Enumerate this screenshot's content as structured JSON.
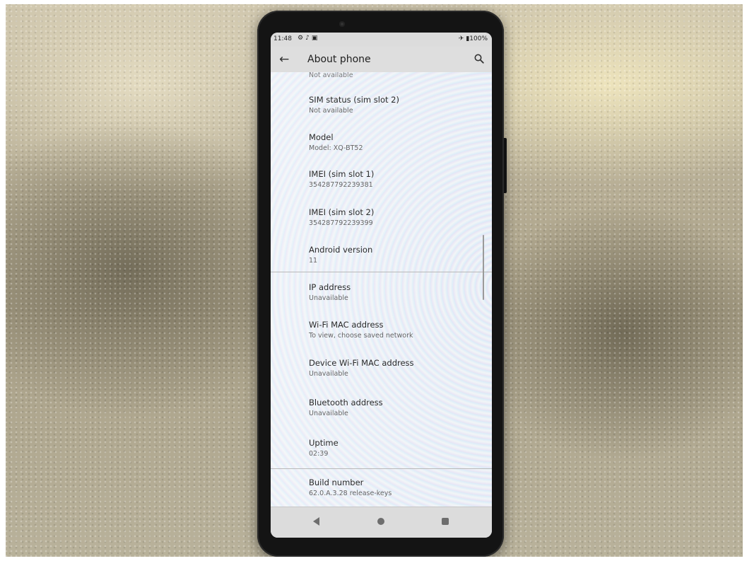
{
  "status_bar": {
    "time": "11:48",
    "left_icons": [
      "gear-icon",
      "music-note-icon",
      "photo-icon"
    ],
    "battery": "100%",
    "airplane_mode": true
  },
  "app_bar": {
    "back_icon": "arrow-left-icon",
    "title": "About phone",
    "search_icon": "search-icon"
  },
  "list": {
    "partial_top_subtitle": "Not available",
    "items": [
      {
        "title": "SIM status (sim slot 2)",
        "subtitle": "Not available"
      },
      {
        "title": "Model",
        "subtitle": "Model: XQ-BT52"
      },
      {
        "title": "IMEI (sim slot 1)",
        "subtitle": "354287792239381"
      },
      {
        "title": "IMEI (sim slot 2)",
        "subtitle": "354287792239399"
      },
      {
        "title": "Android version",
        "subtitle": "11"
      },
      {
        "title": "IP address",
        "subtitle": "Unavailable"
      },
      {
        "title": "Wi-Fi MAC address",
        "subtitle": "To view, choose saved network"
      },
      {
        "title": "Device Wi-Fi MAC address",
        "subtitle": "Unavailable"
      },
      {
        "title": "Bluetooth address",
        "subtitle": "Unavailable"
      },
      {
        "title": "Uptime",
        "subtitle": "02:39"
      },
      {
        "title": "Build number",
        "subtitle": "62.0.A.3.28 release-keys"
      }
    ]
  },
  "nav_bar": {
    "back": "nav-back-icon",
    "home": "nav-home-icon",
    "recents": "nav-recents-icon"
  }
}
